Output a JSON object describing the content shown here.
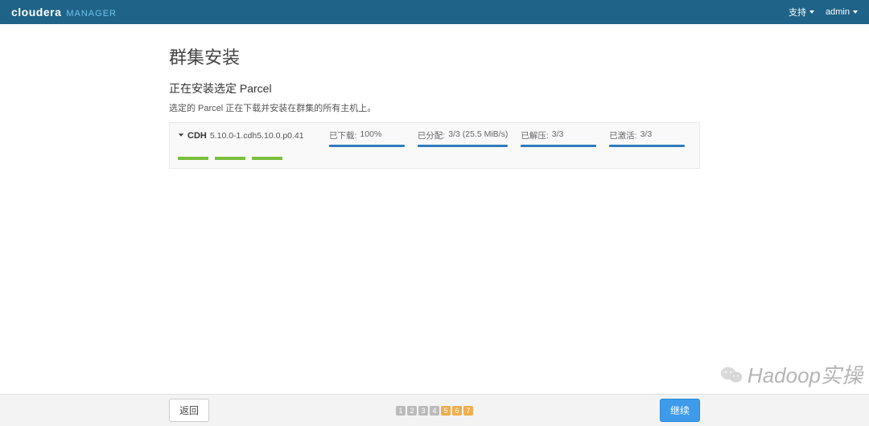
{
  "brand": {
    "main_bold": "cloudera",
    "sub": "MANAGER"
  },
  "nav": {
    "support": "支持",
    "admin": "admin"
  },
  "page": {
    "title": "群集安装",
    "subtitle": "正在安装选定 Parcel",
    "desc_prefix": "选定的 Parcel 正在下载并安装在群集的所有主机上",
    "desc_suffix": "。"
  },
  "parcel": {
    "name": "CDH",
    "version": "5.10.0-1.cdh5.10.0.p0.41",
    "stages": [
      {
        "label": "已下载:",
        "value": "100%"
      },
      {
        "label": "已分配:",
        "value": "3/3 (25.5 MiB/s)"
      },
      {
        "label": "已解压:",
        "value": "3/3"
      },
      {
        "label": "已激活:",
        "value": "3/3"
      }
    ]
  },
  "footer": {
    "back": "返回",
    "continue": "继续",
    "steps": [
      "1",
      "2",
      "3",
      "4",
      "5",
      "6",
      "7"
    ],
    "active_step_index": 4
  },
  "watermark": "Hadoop实操"
}
